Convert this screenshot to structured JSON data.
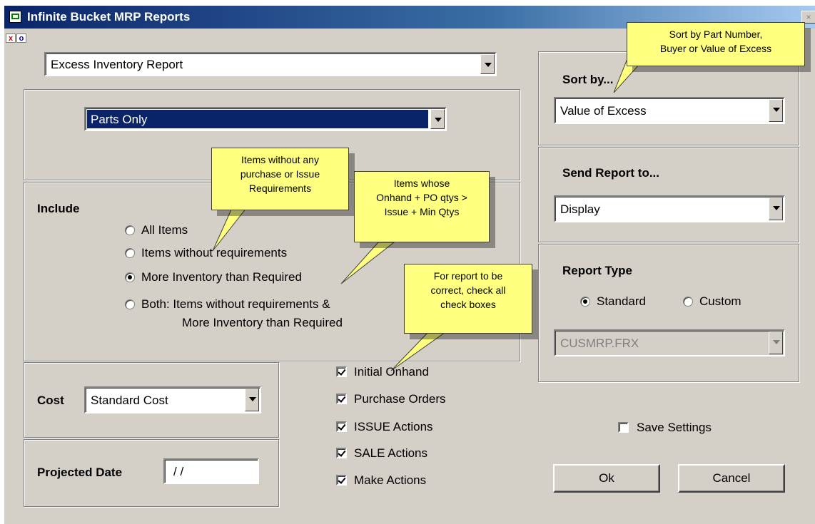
{
  "window": {
    "title": "Infinite Bucket MRP Reports",
    "close_glyph": "×"
  },
  "toolbar": {
    "x_label": "x",
    "o_label": "o"
  },
  "report_select": {
    "value": "Excess Inventory Report"
  },
  "parts_select": {
    "value": "Parts Only"
  },
  "include": {
    "heading": "Include",
    "options": [
      {
        "label": "All Items",
        "selected": false
      },
      {
        "label": "Items without requirements",
        "selected": false
      },
      {
        "label": "More Inventory than Required",
        "selected": true
      },
      {
        "label": "Both: Items without requirements &",
        "label2": "More Inventory than Required",
        "selected": false
      }
    ]
  },
  "cost": {
    "label": "Cost",
    "value": "Standard Cost"
  },
  "projected_date": {
    "label": "Projected Date",
    "value": "/ /"
  },
  "checkboxes": [
    {
      "label": "Initial Onhand",
      "checked": true
    },
    {
      "label": "Purchase Orders",
      "checked": true
    },
    {
      "label": "ISSUE Actions",
      "checked": true
    },
    {
      "label": "SALE Actions",
      "checked": true
    },
    {
      "label": "Make Actions",
      "checked": true
    }
  ],
  "sort_by": {
    "label": "Sort by...",
    "value": "Value of Excess"
  },
  "send_to": {
    "label": "Send Report to...",
    "value": "Display"
  },
  "report_type": {
    "label": "Report Type",
    "standard_label": "Standard",
    "custom_label": "Custom",
    "selected": "Standard",
    "custom_file": "CUSMRP.FRX"
  },
  "save_settings": {
    "label": "Save Settings",
    "checked": false
  },
  "buttons": {
    "ok": "Ok",
    "cancel": "Cancel"
  },
  "tooltips": {
    "sort": [
      "Sort by Part Number,",
      "Buyer or Value of Excess"
    ],
    "no_req": [
      "Items without any",
      "purchase or Issue",
      "Requirements"
    ],
    "whose": [
      "Items whose",
      "Onhand + PO qtys >",
      "Issue + Min Qtys"
    ],
    "report": [
      "For report to be",
      "correct, check all",
      "check boxes"
    ]
  }
}
